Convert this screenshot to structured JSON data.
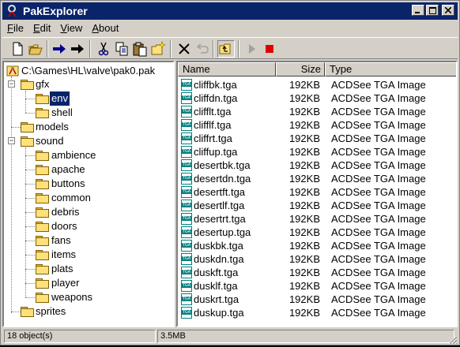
{
  "window": {
    "title": "PakExplorer"
  },
  "menu": [
    {
      "label": "File",
      "u": "F",
      "rest": "ile"
    },
    {
      "label": "Edit",
      "u": "E",
      "rest": "dit"
    },
    {
      "label": "View",
      "u": "V",
      "rest": "iew"
    },
    {
      "label": "About",
      "u": "A",
      "rest": "bout"
    }
  ],
  "toolbar": [
    "new-file-icon",
    "open-folder-icon",
    "move-right-icon",
    "move-right-black-icon",
    "cut-icon",
    "copy-icon",
    "paste-icon",
    "new-folder-icon",
    "delete-icon",
    "undo-icon",
    "folder-up-icon",
    "play-icon",
    "stop-icon"
  ],
  "tree": {
    "root": "C:\\Games\\HL\\valve\\pak0.pak",
    "gfx": "gfx",
    "env": "env",
    "shell": "shell",
    "models": "models",
    "sound": "sound",
    "sound_children": [
      "ambience",
      "apache",
      "buttons",
      "common",
      "debris",
      "doors",
      "fans",
      "items",
      "plats",
      "player",
      "weapons"
    ],
    "sprites": "sprites"
  },
  "list": {
    "headers": {
      "name": "Name",
      "size": "Size",
      "type": "Type"
    },
    "rows": [
      {
        "name": "cliffbk.tga",
        "size": "192KB",
        "type": "ACDSee TGA Image"
      },
      {
        "name": "cliffdn.tga",
        "size": "192KB",
        "type": "ACDSee TGA Image"
      },
      {
        "name": "clifflt.tga",
        "size": "192KB",
        "type": "ACDSee TGA Image"
      },
      {
        "name": "clifflf.tga",
        "size": "192KB",
        "type": "ACDSee TGA Image"
      },
      {
        "name": "cliffrt.tga",
        "size": "192KB",
        "type": "ACDSee TGA Image"
      },
      {
        "name": "cliffup.tga",
        "size": "192KB",
        "type": "ACDSee TGA Image"
      },
      {
        "name": "desertbk.tga",
        "size": "192KB",
        "type": "ACDSee TGA Image"
      },
      {
        "name": "desertdn.tga",
        "size": "192KB",
        "type": "ACDSee TGA Image"
      },
      {
        "name": "desertft.tga",
        "size": "192KB",
        "type": "ACDSee TGA Image"
      },
      {
        "name": "desertlf.tga",
        "size": "192KB",
        "type": "ACDSee TGA Image"
      },
      {
        "name": "desertrt.tga",
        "size": "192KB",
        "type": "ACDSee TGA Image"
      },
      {
        "name": "desertup.tga",
        "size": "192KB",
        "type": "ACDSee TGA Image"
      },
      {
        "name": "duskbk.tga",
        "size": "192KB",
        "type": "ACDSee TGA Image"
      },
      {
        "name": "duskdn.tga",
        "size": "192KB",
        "type": "ACDSee TGA Image"
      },
      {
        "name": "duskft.tga",
        "size": "192KB",
        "type": "ACDSee TGA Image"
      },
      {
        "name": "dusklf.tga",
        "size": "192KB",
        "type": "ACDSee TGA Image"
      },
      {
        "name": "duskrt.tga",
        "size": "192KB",
        "type": "ACDSee TGA Image"
      },
      {
        "name": "duskup.tga",
        "size": "192KB",
        "type": "ACDSee TGA Image"
      }
    ]
  },
  "status": {
    "count": "18 object(s)",
    "size": "3.5MB"
  }
}
